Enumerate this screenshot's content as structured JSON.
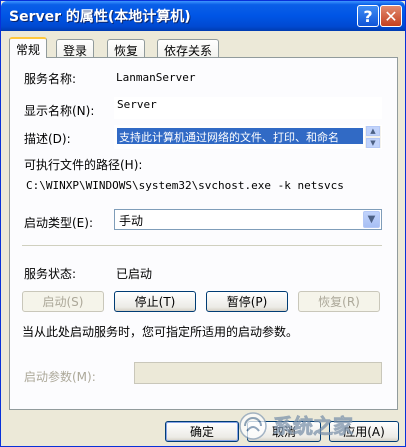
{
  "window": {
    "title": "Server 的属性(本地计算机)",
    "help_glyph": "?",
    "close_glyph": "✕"
  },
  "tabs": [
    {
      "label": "常规",
      "active": true
    },
    {
      "label": "登录",
      "active": false
    },
    {
      "label": "恢复",
      "active": false
    },
    {
      "label": "依存关系",
      "active": false
    }
  ],
  "general": {
    "service_name_label": "服务名称:",
    "service_name_value": "LanmanServer",
    "display_name_label": "显示名称(N):",
    "display_name_value": "Server",
    "description_label": "描述(D):",
    "description_value": "支持此计算机通过网络的文件、打印、和命名",
    "exe_path_label": "可执行文件的路径(H):",
    "exe_path_value": "C:\\WINXP\\WINDOWS\\system32\\svchost.exe -k netsvcs",
    "startup_type_label": "启动类型(E):",
    "startup_type_value": "手动",
    "service_status_label": "服务状态:",
    "service_status_value": "已启动",
    "hint_text": "当从此处启动服务时，您可指定所适用的启动参数。",
    "start_params_label": "启动参数(M):",
    "start_params_value": ""
  },
  "service_buttons": {
    "start": "启动(S)",
    "stop": "停止(T)",
    "pause": "暂停(P)",
    "resume": "恢复(R)"
  },
  "dialog_buttons": {
    "ok": "确定",
    "cancel": "取消",
    "apply": "应用(A)"
  },
  "icons": {
    "help": "help-icon",
    "close": "close-icon",
    "scroll_up": "scroll-up-icon",
    "scroll_down": "scroll-down-icon",
    "dropdown": "chevron-down-icon"
  },
  "watermark_text": "系统之家"
}
